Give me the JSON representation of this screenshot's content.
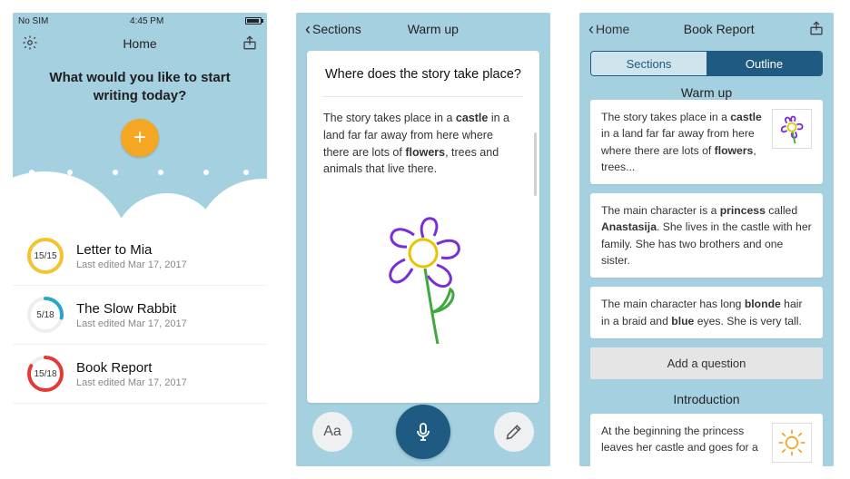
{
  "screen1": {
    "status": {
      "carrier": "No SIM",
      "time": "4:45 PM"
    },
    "nav": {
      "title": "Home"
    },
    "hero": "What would you like to start writing today?",
    "docs": [
      {
        "title": "Letter to Mia",
        "sub": "Last edited Mar 17, 2017",
        "count": "15/15",
        "pct": 100,
        "color": "#f4c430"
      },
      {
        "title": "The Slow Rabbit",
        "sub": "Last edited Mar 17, 2017",
        "count": "5/18",
        "pct": 28,
        "color": "#2aa6c9"
      },
      {
        "title": "Book Report",
        "sub": "Last edited Mar 17, 2017",
        "count": "15/18",
        "pct": 83,
        "color": "#e53935"
      }
    ]
  },
  "screen2": {
    "back": "Sections",
    "title": "Warm up",
    "question": "Where does the story take place?",
    "story_pre": "The story takes place in a ",
    "story_b1": "castle",
    "story_mid": " in a land far far away from here where there are lots of ",
    "story_b2": "flowers",
    "story_post": ", trees and animals that live there.",
    "aa": "Aa"
  },
  "screen3": {
    "back": "Home",
    "title": "Book Report",
    "seg": {
      "left": "Sections",
      "right": "Outline"
    },
    "section1": "Warm up",
    "entries1": [
      {
        "pre": "The story takes place in a ",
        "b1": "castle",
        "mid": " in a land far far away from here where there are lots of ",
        "b2": "flowers",
        "post": ", trees...",
        "thumb": "flower"
      },
      {
        "pre": "The main character is a ",
        "b1": "princess",
        "mid": " called ",
        "b2": "Anastasija",
        "post": ". She lives in the castle with her family. She has two brothers and one sister."
      },
      {
        "pre": "The main character has long ",
        "b1": "blonde",
        "mid": " hair in a braid and ",
        "b2": "blue",
        "post": " eyes. She is very tall."
      }
    ],
    "add_q": "Add a question",
    "section2": "Introduction",
    "entry4": "At the beginning the princess leaves her castle and goes for a"
  }
}
